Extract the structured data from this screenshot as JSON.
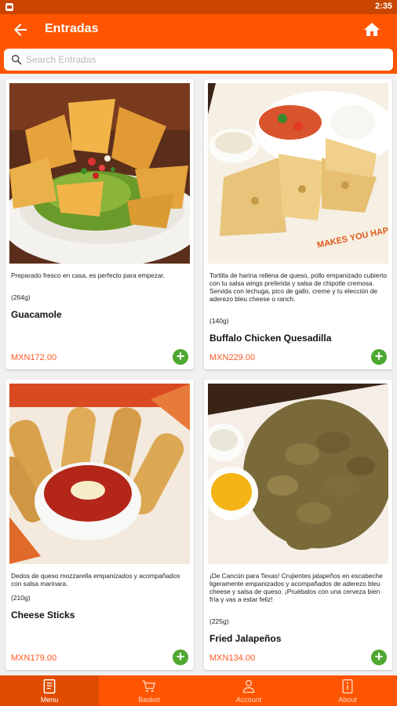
{
  "status_bar": {
    "time": "2:35"
  },
  "header": {
    "title": "Entradas"
  },
  "search": {
    "placeholder": "Search Entradas"
  },
  "products": [
    {
      "description": "Preparado fresco en casa, es perfecto para empezar.",
      "weight": "(264g)",
      "name": "Guacamole",
      "price": "MXN172.00"
    },
    {
      "description": "Tortilla de harina rellena de queso, pollo empanizado cubierto con tu salsa wings preferida y salsa de chipotle cremosa. Servida con lechuga, pico de gallo, creme y tu elección de aderezo bleu cheese o ranch.",
      "weight": "(140g)",
      "name": "Buffalo Chicken Quesadilla",
      "price": "MXN229.00"
    },
    {
      "description": "Dedos de queso mozzarella empanizados y acompañados con salsa marinara.",
      "weight": "(210g)",
      "name": "Cheese Sticks",
      "price": "MXN179.00"
    },
    {
      "description": "¡De Cancún para Texas! Crujientes jalapeños en escabeche ligeramente empanizados y acompañados de aderezo bleu cheese y salsa de queso. ¡Pruébalos con una cerveza bien fría y vas a estar feliz!",
      "weight": "(225g)",
      "name": "Fried Jalapeños",
      "price": "MXN134.00"
    }
  ],
  "photo_text": {
    "quesadilla_paper": "MAKES YOU HAPPY!"
  },
  "bottom_nav": [
    {
      "label": "Menu",
      "icon": "menu-book-icon",
      "active": true
    },
    {
      "label": "Basket",
      "icon": "cart-icon",
      "active": false
    },
    {
      "label": "Account",
      "icon": "person-icon",
      "active": false
    },
    {
      "label": "About",
      "icon": "info-icon",
      "active": false
    }
  ],
  "colors": {
    "primary": "#ff5500",
    "status_bar": "#c94500",
    "price": "#ff5722",
    "add_button": "#4fa832"
  }
}
